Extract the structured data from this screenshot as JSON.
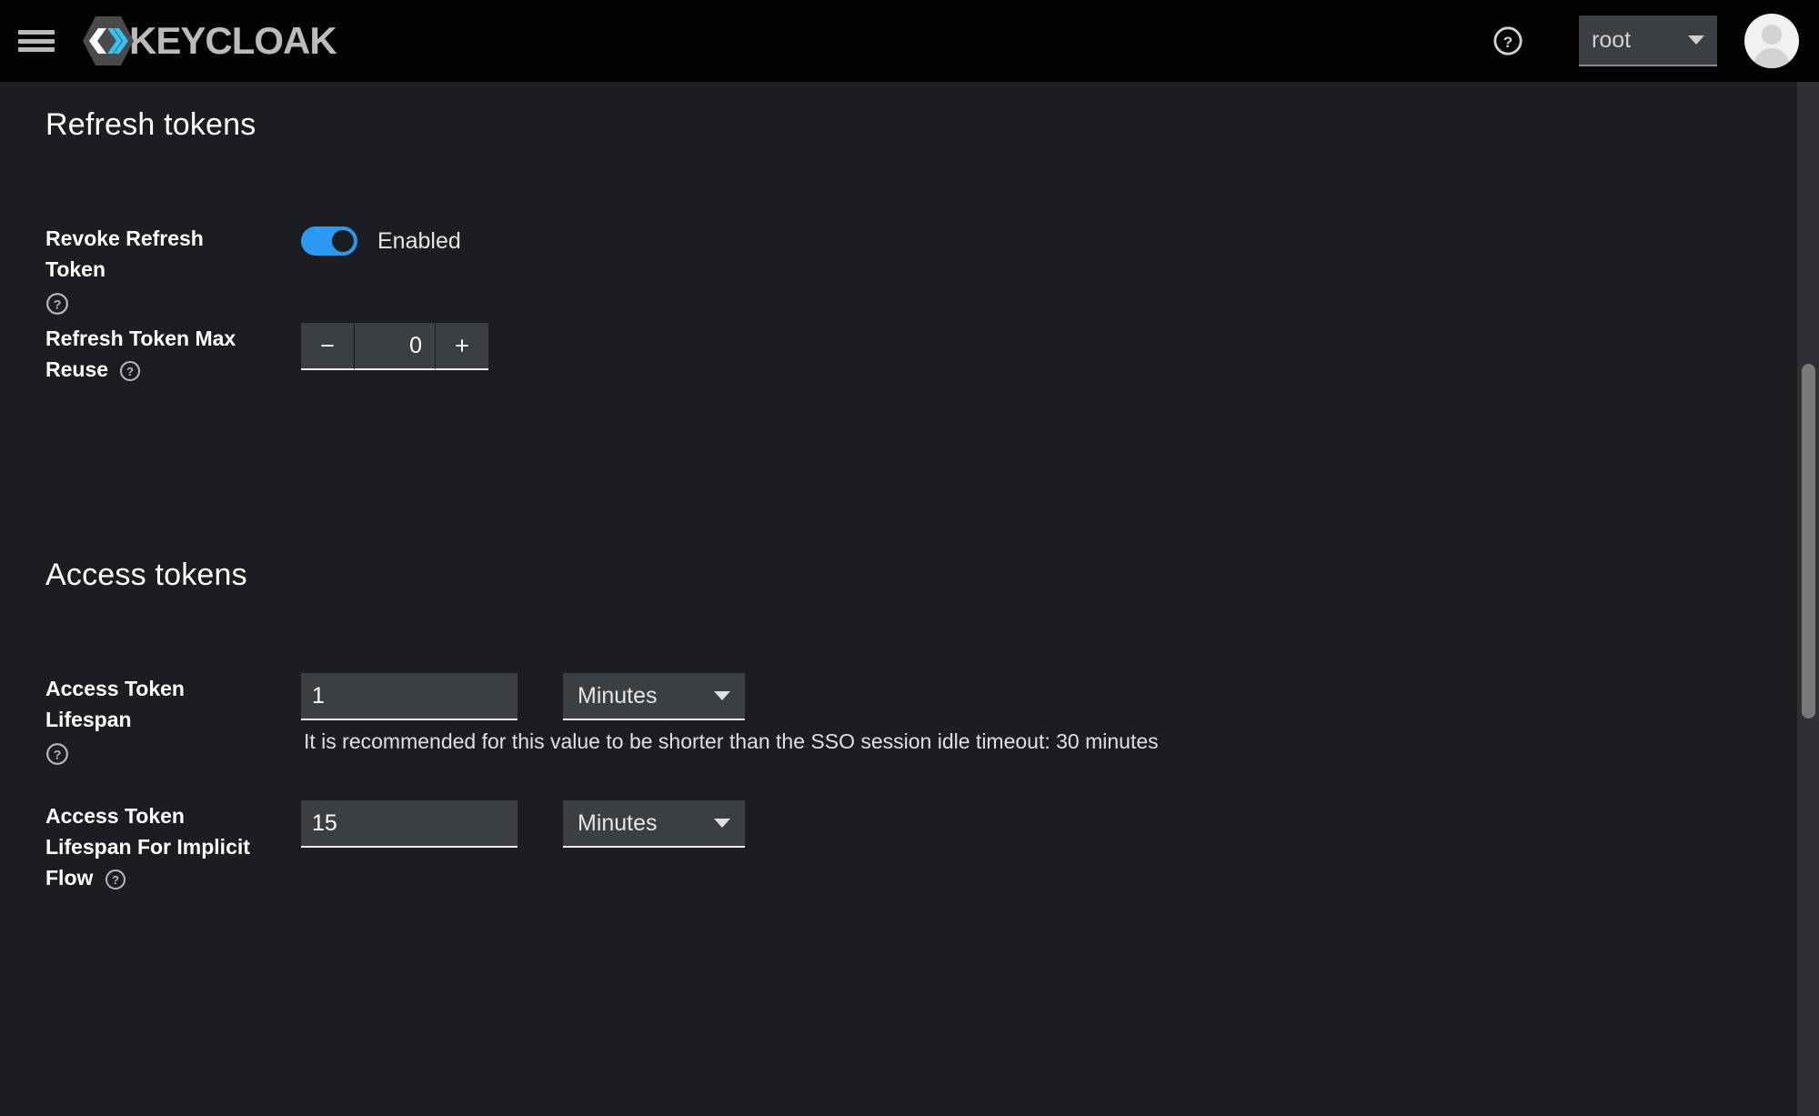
{
  "masthead": {
    "menu_icon": "hamburger-icon",
    "brand": {
      "logo_icon": "keycloak-logo-icon",
      "text": "KEYCLOAK"
    },
    "help_icon": "question-circle-icon",
    "realm_selector": {
      "value": "root",
      "caret_icon": "caret-down-icon"
    },
    "avatar_icon": "user-avatar-icon"
  },
  "sections": {
    "refresh_tokens": {
      "title": "Refresh tokens",
      "revoke_refresh_token": {
        "label": "Revoke Refresh Token",
        "help_icon": "question-circle-icon",
        "toggle_state": "on",
        "toggle_text": "Enabled"
      },
      "refresh_token_max_reuse": {
        "label": "Refresh Token Max Reuse",
        "help_icon": "question-circle-icon",
        "minus_label": "−",
        "value": "0",
        "plus_label": "+"
      }
    },
    "access_tokens": {
      "title": "Access tokens",
      "access_token_lifespan": {
        "label": "Access Token Lifespan",
        "help_icon": "question-circle-icon",
        "value": "1",
        "unit": "Minutes",
        "unit_caret_icon": "caret-down-icon",
        "helper_text": "It is recommended for this value to be shorter than the SSO session idle timeout: 30 minutes"
      },
      "access_token_lifespan_implicit": {
        "label": "Access Token Lifespan For Implicit Flow",
        "help_icon": "question-circle-icon",
        "value": "15",
        "unit": "Minutes",
        "unit_caret_icon": "caret-down-icon"
      }
    }
  },
  "scrollbar": {
    "name": "vertical-scrollbar"
  },
  "colors": {
    "accent_blue": "#2b9af3",
    "masthead_bg": "#030303",
    "content_bg": "#1b1d21",
    "input_bg": "#3c3f42"
  }
}
